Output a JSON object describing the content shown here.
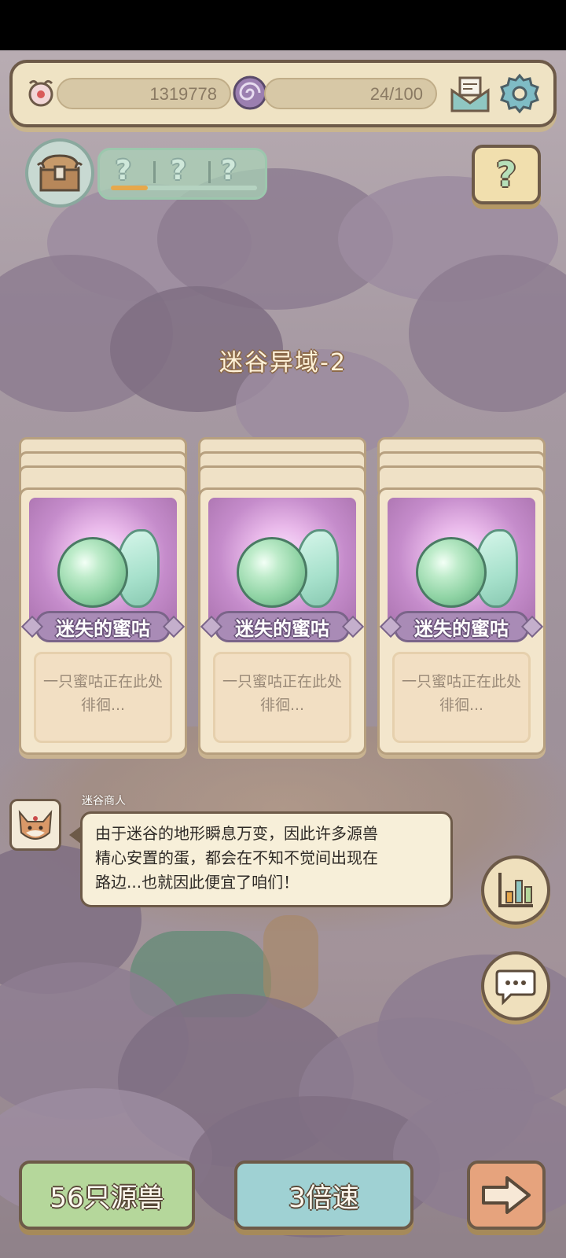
{
  "topbar": {
    "gold_value": "1319778",
    "energy_value": "24/100",
    "icons": [
      "rune-icon",
      "spiral-icon",
      "mail-icon",
      "gear-icon"
    ]
  },
  "quest": {
    "marks": [
      "?",
      "?",
      "?"
    ],
    "progress": 0.25
  },
  "help_label": "?",
  "stage_title": "迷谷异域-2",
  "cards": [
    {
      "name": "迷失的蜜咕",
      "desc_line1": "一只蜜咕正在此处",
      "desc_line2": "徘徊..."
    },
    {
      "name": "迷失的蜜咕",
      "desc_line1": "一只蜜咕正在此处",
      "desc_line2": "徘徊..."
    },
    {
      "name": "迷失的蜜咕",
      "desc_line1": "一只蜜咕正在此处",
      "desc_line2": "徘徊..."
    }
  ],
  "dialogue": {
    "speaker": "迷谷商人",
    "line1": "由于迷谷的地形瞬息万变，因此许多源兽",
    "line2": "精心安置的蛋，都会在不知不觉间出现在",
    "line3": "路边...也就因此便宜了咱们！"
  },
  "bottom": {
    "beasts_label": "56只源兽",
    "speed_label": "3倍速"
  },
  "colors": {
    "frame": "#6d5a48",
    "panel": "#efe3c4",
    "card_name": "#a98bb6",
    "green_btn": "#b5d79b",
    "blue_btn": "#9fd1d3",
    "orange_btn": "#e6a37d"
  }
}
